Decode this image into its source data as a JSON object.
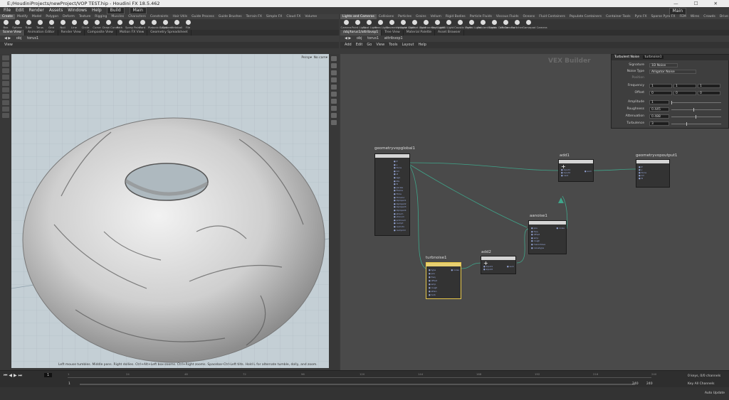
{
  "window": {
    "title": "E:/HoudiniProjects/newProject/VOP TEST.hip - Houdini FX 18.5.462",
    "controls": "—  ☐  ✕"
  },
  "menu": [
    "File",
    "Edit",
    "Render",
    "Assets",
    "Windows",
    "Help"
  ],
  "desktop": {
    "left": "Build",
    "right": "Main",
    "far_right": "Main"
  },
  "shelf_left": {
    "tabs": [
      "Create",
      "Modify",
      "Model",
      "Polygon",
      "Deform",
      "Texture",
      "Rigging",
      "Muscles",
      "Characters",
      "Constraints",
      "Hair Utils",
      "Guide Process",
      "Guide Brushes",
      "Terrain FX",
      "Simple FX",
      "Cloud FX",
      "Volume"
    ],
    "tools": [
      "Box",
      "Sphere",
      "Tube",
      "Torus",
      "Grid",
      "Null",
      "Line",
      "Circle",
      "Curve",
      "Draw Curve",
      "Path",
      "Spray Paint",
      "Font",
      "Platonic Solids",
      "L-System",
      "Metaball",
      "File"
    ]
  },
  "shelf_right": {
    "tabs": [
      "Lights and Cameras",
      "Collisions",
      "Particles",
      "Grains",
      "Vellum",
      "Rigid Bodies",
      "Particle Fluids",
      "Viscous Fluids",
      "Oceans",
      "Fluid Containers",
      "Populate Containers",
      "Container Tools",
      "Pyro FX",
      "Sparse Pyro FX",
      "FEM",
      "Wires",
      "Crowds",
      "Drive Simulation"
    ],
    "tools": [
      "Camera",
      "Point Light",
      "Spot Light",
      "Area Light",
      "Geometry Light",
      "Volume Light",
      "Distant Light",
      "Environment Light",
      "Sky Light",
      "GI Light",
      "Caustic Light",
      "Portal Light",
      "Ambient Light",
      "Stereo Camera",
      "VR Camera",
      "Switcher",
      "Gamepad Camera"
    ]
  },
  "left_pane": {
    "tabs": [
      "Scene View",
      "Animation Editor",
      "Render View",
      "Composite View",
      "Motion FX View",
      "Geometry Spreadsheet"
    ],
    "path": [
      "obj",
      "torus1"
    ],
    "view_label": "View",
    "persp": "Persp▾",
    "cam": "No cam▾",
    "hint": "Left mouse tumbles. Middle pans. Right dollies. Ctrl+Alt+Left box-zooms. Ctrl+Right zooms. Spacebar-Ctrl-Left tilts. Hold L for alternate tumble, dolly, and zoom."
  },
  "right_pane": {
    "tabs": [
      "/obj/torus1/attribvop1",
      "Tree View",
      "Material Palette",
      "Asset Browser"
    ],
    "path": [
      "obj",
      "torus1",
      "attribvop1"
    ],
    "menu": [
      "Add",
      "Edit",
      "Go",
      "View",
      "Tools",
      "Layout",
      "Help"
    ],
    "title": "VEX Builder"
  },
  "nodes": {
    "geomglobal": {
      "label": "geometryvopglobal1",
      "ports": [
        "P",
        "v",
        "force",
        "Cd",
        "id",
        "age",
        "life",
        "N",
        "pscale",
        "Frame",
        "Time",
        "TimeInc",
        "OpInput1",
        "OpInput2",
        "OpInput3",
        "OpInput4",
        "ptnum",
        "vtxnum",
        "primnum",
        "numpt",
        "numvtx",
        "numprim"
      ]
    },
    "add1": {
      "label": "add1",
      "ports": [
        "input1",
        "input2",
        "next"
      ],
      "out": "sum"
    },
    "geomout": {
      "label": "geometryvopoutput1",
      "ports": [
        "P",
        "v",
        "force",
        "Cd",
        "N"
      ]
    },
    "aanoise": {
      "label": "aanoise1",
      "ports": [
        "pos",
        "freq",
        "offset",
        "amp",
        "rough",
        "maxoctave",
        "noisetype"
      ],
      "out": "noise"
    },
    "turbnoise": {
      "label": "turbnoise1",
      "ports": [
        "type",
        "pos",
        "freq",
        "offset",
        "amp",
        "rough",
        "atten",
        "turb"
      ],
      "out": "noise"
    },
    "add2": {
      "label": "add2",
      "ports": [
        "input1",
        "input2"
      ],
      "out": "sum"
    }
  },
  "params": {
    "header": "Turbulent Noise",
    "name": "turbnoise1",
    "signature": {
      "label": "Signature",
      "value": "1D Noise"
    },
    "noise_type": {
      "label": "Noise Type",
      "value": "Alligator Noise"
    },
    "position": {
      "label": "Position"
    },
    "frequency": {
      "label": "Frequency",
      "values": [
        "1",
        "1",
        "1"
      ]
    },
    "offset": {
      "label": "Offset",
      "values": [
        "0",
        "0",
        "0"
      ]
    },
    "amplitude": {
      "label": "Amplitude",
      "value": "1",
      "fraction": 0.0
    },
    "roughness": {
      "label": "Roughness",
      "value": "0.445",
      "fraction": 0.445
    },
    "attenuation": {
      "label": "Attenuation",
      "value": "0.488",
      "fraction": 0.488
    },
    "turbulence": {
      "label": "Turbulence",
      "value": "3",
      "fraction": 0.3
    }
  },
  "timeline": {
    "frame": "1",
    "start": "1",
    "end": "240",
    "end2": "240",
    "ticks": [
      "1",
      "24",
      "48",
      "72",
      "96",
      "120",
      "144",
      "168",
      "192",
      "216",
      "240"
    ],
    "keys": "0 keys, 0/0 channels",
    "key_all": "Key All Channels",
    "auto_update": "Auto Update"
  }
}
